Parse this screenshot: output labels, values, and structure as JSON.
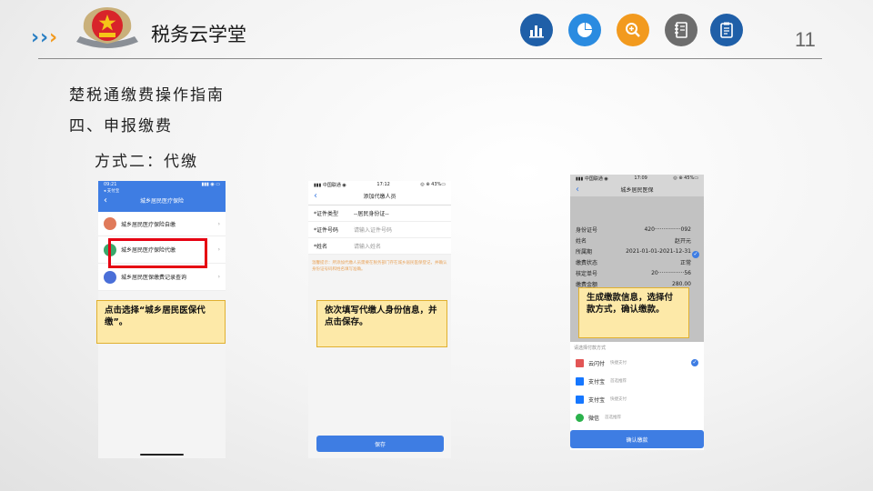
{
  "header": {
    "brand": "税务云学堂",
    "page_number": "11",
    "icons": [
      "bar-chart-icon",
      "pie-chart-icon",
      "search-icon",
      "notebook-icon",
      "clipboard-icon"
    ]
  },
  "titles": {
    "line1": "楚税通缴费操作指南",
    "line2": "四、申报缴费",
    "line3": "方式二：代缴"
  },
  "phone1": {
    "time": "09:21",
    "carrier": "◂ 支付宝",
    "signal": "▮▮▮ ◉ ▭",
    "nav_title": "城乡居民医疗保险",
    "back": "‹",
    "items": [
      {
        "label": "城乡居民医疗保险自缴"
      },
      {
        "label": "城乡居民医疗保险代缴"
      },
      {
        "label": "城乡居民医保缴费记录查询"
      }
    ],
    "arrow": "›",
    "note": "点击选择“城乡居民医保代缴”。"
  },
  "phone2": {
    "carrier": "▮▮▮ 中国联通 ◉",
    "time": "17:12",
    "battery": "◎ ⊕ 43%▭",
    "nav_title": "添加代缴人员",
    "back": "‹",
    "rows": [
      {
        "label": "*证件类型",
        "value": "--居民身份证--"
      },
      {
        "label": "*证件号码",
        "value": "请输入证件号码"
      },
      {
        "label": "*姓名",
        "value": "请输入姓名"
      }
    ],
    "tip": "温馨提示：所添加代缴人员需要在税务部门存在城乡居民医保登记，并确认身份证号码和姓名填写准确。",
    "save": "保存",
    "note": "依次填写代缴人身份信息，并点击保存。"
  },
  "phone3": {
    "carrier": "▮▮▮ 中国联通 ◉",
    "time": "17:09",
    "battery": "◎ ⊕ 45%▭",
    "nav_title": "城乡居民医保",
    "back": "‹",
    "info": [
      {
        "label": "身份证号",
        "value": "420···············092"
      },
      {
        "label": "姓名",
        "value": "赵开元"
      },
      {
        "label": "所属期",
        "value": "2021-01-01-2021-12-31"
      },
      {
        "label": "缴费状态",
        "value": "正常"
      },
      {
        "label": "核定单号",
        "value": "20···············56"
      },
      {
        "label": "缴费金额",
        "value": "280.00"
      }
    ],
    "pay_title": "请选择付款方式",
    "pay": [
      {
        "name": "云闪付",
        "sub": "快捷支付",
        "icon": "unionpay-icon"
      },
      {
        "name": "支付宝",
        "sub": "首选推荐",
        "icon": "alipay-icon"
      },
      {
        "name": "支付宝",
        "sub": "快捷支付",
        "icon": "alipay-icon"
      },
      {
        "name": "微信",
        "sub": "首选推荐",
        "icon": "wechat-icon"
      }
    ],
    "confirm": "确认缴款",
    "note": "生成缴款信息，选择付款方式，确认缴款。"
  },
  "colors": {
    "accent": "#2a7fc3",
    "highlight": "#e60012",
    "note_bg": "#fde9a8",
    "button": "#3e7de3"
  }
}
